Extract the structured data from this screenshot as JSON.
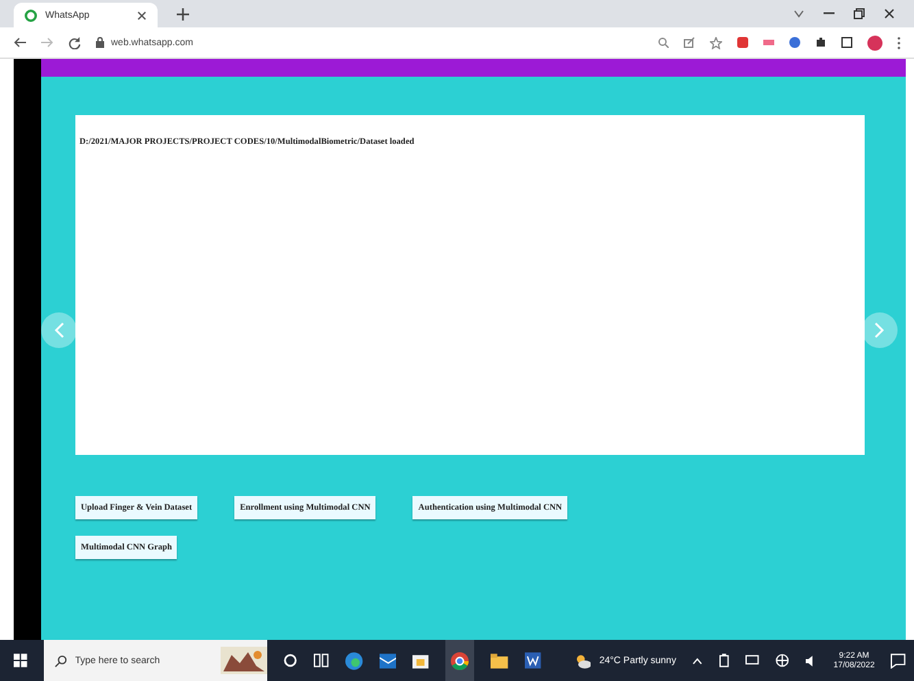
{
  "browser": {
    "tab_title": "WhatsApp",
    "url": "web.whatsapp.com"
  },
  "app": {
    "status_text": "D:/2021/MAJOR PROJECTS/PROJECT CODES/10/MultimodalBiometric/Dataset loaded",
    "buttons": [
      "Upload Finger & Vein Dataset",
      "Enrollment using Multimodal CNN",
      "Authentication using Multimodal CNN",
      "Multimodal CNN Graph"
    ]
  },
  "taskbar": {
    "search": {
      "placeholder": "Type here to search"
    },
    "weather": "24°C  Partly sunny",
    "time": "9:22 AM",
    "date": "17/08/2022"
  }
}
